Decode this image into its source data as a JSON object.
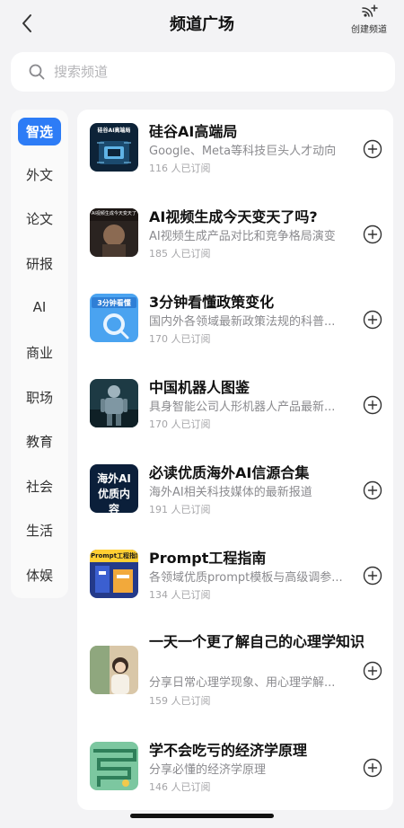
{
  "header": {
    "title": "频道广场",
    "create_label": "创建频道",
    "icons": {
      "back": "chevron-left-icon",
      "create": "broadcast-plus-icon"
    }
  },
  "search": {
    "placeholder": "搜索频道",
    "value": "",
    "icon": "search-icon"
  },
  "sidebar": {
    "items": [
      {
        "label": "智选",
        "active": true
      },
      {
        "label": "外文"
      },
      {
        "label": "论文"
      },
      {
        "label": "研报"
      },
      {
        "label": "AI"
      },
      {
        "label": "商业"
      },
      {
        "label": "职场"
      },
      {
        "label": "教育"
      },
      {
        "label": "社会"
      },
      {
        "label": "生活"
      },
      {
        "label": "体娱"
      }
    ]
  },
  "channels": [
    {
      "title": "硅谷AI高端局",
      "desc": "Google、Meta等科技巨头人才动向",
      "subs": "116 人已订阅",
      "thumb_text": "硅谷AI高端局",
      "add_icon": "plus-circle-icon"
    },
    {
      "title": "AI视频生成今天变天了吗?",
      "desc": "AI视频生成产品对比和竞争格局演变",
      "subs": "185 人已订阅",
      "thumb_text": "AI视频生成今天变天了吗?",
      "add_icon": "plus-circle-icon"
    },
    {
      "title": "3分钟看懂政策变化",
      "desc": "国内外各领域最新政策法规的科普...",
      "subs": "170 人已订阅",
      "thumb_text": "3分钟看懂",
      "add_icon": "plus-circle-icon"
    },
    {
      "title": "中国机器人图鉴",
      "desc": "具身智能公司人形机器人产品最新...",
      "subs": "170 人已订阅",
      "thumb_text": "",
      "add_icon": "plus-circle-icon"
    },
    {
      "title": "必读优质海外AI信源合集",
      "desc": "海外AI相关科技媒体的最新报道",
      "subs": "191 人已订阅",
      "thumb_text": "海外AI优质内容",
      "add_icon": "plus-circle-icon"
    },
    {
      "title": "Prompt工程指南",
      "desc": "各领域优质prompt模板与高级调参...",
      "subs": "134 人已订阅",
      "thumb_text": "Prompt工程指南",
      "add_icon": "plus-circle-icon"
    },
    {
      "title": "一天一个更了解自己的心理学知识",
      "desc": "分享日常心理学现象、用心理学解...",
      "subs": "159 人已订阅",
      "thumb_text": "",
      "add_icon": "plus-circle-icon"
    },
    {
      "title": "学不会吃亏的经济学原理",
      "desc": "分享必懂的经济学原理",
      "subs": "146 人已订阅",
      "thumb_text": "",
      "add_icon": "plus-circle-icon"
    }
  ]
}
